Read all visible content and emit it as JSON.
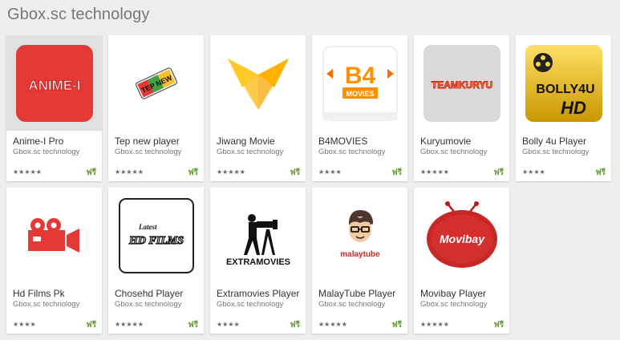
{
  "header": {
    "title": "Gbox.sc technology"
  },
  "colors": {
    "background": "#eeeeee",
    "price": "#689f38",
    "stars": "#666666"
  },
  "apps": [
    {
      "name": "Anime-I Pro",
      "developer": "Gbox.sc technology",
      "rating_stars": "★★★★★",
      "price": "ฟรี",
      "icon": "anime-i-icon",
      "icon_text": "ANIME-I"
    },
    {
      "name": "Tep new player",
      "developer": "Gbox.sc technology",
      "rating_stars": "★★★★★",
      "price": "ฟรี",
      "icon": "tep-new-icon",
      "icon_text": "TEP NEW"
    },
    {
      "name": "Jiwang Movie",
      "developer": "Gbox.sc technology",
      "rating_stars": "★★★★★",
      "price": "ฟรี",
      "icon": "jiwang-fox-icon",
      "icon_text": ""
    },
    {
      "name": "B4MOVIES",
      "developer": "Gbox.sc technology",
      "rating_stars": "★★★★",
      "price": "ฟรี",
      "icon": "b4movies-icon",
      "icon_text": "B4",
      "icon_subtext": "MOVIES"
    },
    {
      "name": "Kuryumovie",
      "developer": "Gbox.sc technology",
      "rating_stars": "★★★★★",
      "price": "ฟรี",
      "icon": "kuryumovie-icon",
      "icon_text": "TEAMKURYU"
    },
    {
      "name": "Bolly 4u Player",
      "developer": "Gbox.sc technology",
      "rating_stars": "★★★★",
      "price": "ฟรี",
      "icon": "bolly4u-icon",
      "icon_text": "BOLLY4U",
      "icon_subtext": "HD"
    },
    {
      "name": "Hd Films Pk",
      "developer": "Gbox.sc technology",
      "rating_stars": "★★★★",
      "price": "ฟรี",
      "icon": "video-camera-icon",
      "icon_text": ""
    },
    {
      "name": "Chosehd Player",
      "developer": "Gbox.sc technology",
      "rating_stars": "★★★★★",
      "price": "ฟรี",
      "icon": "hd-films-icon",
      "icon_text": "HD FILMS",
      "icon_subtext": "Latest"
    },
    {
      "name": "Extramovies Player",
      "developer": "Gbox.sc technology",
      "rating_stars": "★★★★",
      "price": "ฟรี",
      "icon": "extramovies-icon",
      "icon_text": "EXTRAMOVIES"
    },
    {
      "name": "MalayTube Player",
      "developer": "Gbox.sc technology",
      "rating_stars": "★★★★★",
      "price": "ฟรี",
      "icon": "malaytube-icon",
      "icon_text": "malaytube"
    },
    {
      "name": "Movibay Player",
      "developer": "Gbox.sc technology",
      "rating_stars": "★★★★★",
      "price": "ฟรี",
      "icon": "movibay-icon",
      "icon_text": "Movibay"
    }
  ]
}
